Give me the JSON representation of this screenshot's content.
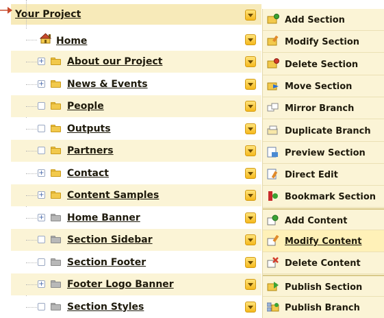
{
  "tree": {
    "root": {
      "label": "Your Project"
    },
    "home": {
      "label": "Home"
    },
    "items": [
      {
        "label": "About our Project",
        "expandable": true,
        "folder": "yellow"
      },
      {
        "label": "News & Events",
        "expandable": true,
        "folder": "yellow"
      },
      {
        "label": "People",
        "expandable": false,
        "folder": "yellow"
      },
      {
        "label": "Outputs",
        "expandable": false,
        "folder": "yellow"
      },
      {
        "label": "Partners",
        "expandable": false,
        "folder": "yellow"
      },
      {
        "label": "Contact",
        "expandable": true,
        "folder": "yellow"
      },
      {
        "label": "Content Samples",
        "expandable": true,
        "folder": "yellow"
      },
      {
        "label": "Home Banner",
        "expandable": true,
        "folder": "gray"
      },
      {
        "label": "Section Sidebar",
        "expandable": false,
        "folder": "gray"
      },
      {
        "label": "Section Footer",
        "expandable": false,
        "folder": "gray"
      },
      {
        "label": "Footer Logo Banner",
        "expandable": true,
        "folder": "gray"
      },
      {
        "label": "Section Styles",
        "expandable": false,
        "folder": "gray"
      }
    ]
  },
  "menu": {
    "items": [
      {
        "label": "Add Section",
        "icon": "add-section-icon"
      },
      {
        "label": "Modify Section",
        "icon": "modify-section-icon"
      },
      {
        "label": "Delete Section",
        "icon": "delete-section-icon"
      },
      {
        "label": "Move Section",
        "icon": "move-section-icon"
      },
      {
        "label": "Mirror Branch",
        "icon": "mirror-branch-icon"
      },
      {
        "label": "Duplicate Branch",
        "icon": "duplicate-branch-icon"
      },
      {
        "label": "Preview Section",
        "icon": "preview-section-icon"
      },
      {
        "label": "Direct Edit",
        "icon": "direct-edit-icon"
      },
      {
        "label": "Bookmark Section",
        "icon": "bookmark-section-icon"
      },
      {
        "label": "Add Content",
        "icon": "add-content-icon"
      },
      {
        "label": "Modify Content",
        "icon": "modify-content-icon",
        "active": true
      },
      {
        "label": "Delete Content",
        "icon": "delete-content-icon"
      },
      {
        "label": "Publish Section",
        "icon": "publish-section-icon"
      },
      {
        "label": "Publish Branch",
        "icon": "publish-branch-icon"
      }
    ]
  },
  "colors": {
    "accent": "#c84a2c",
    "row_tint": "#fbf4d6",
    "menu_bg": "#fbf4d6",
    "dropdown": "#f5b81d"
  }
}
